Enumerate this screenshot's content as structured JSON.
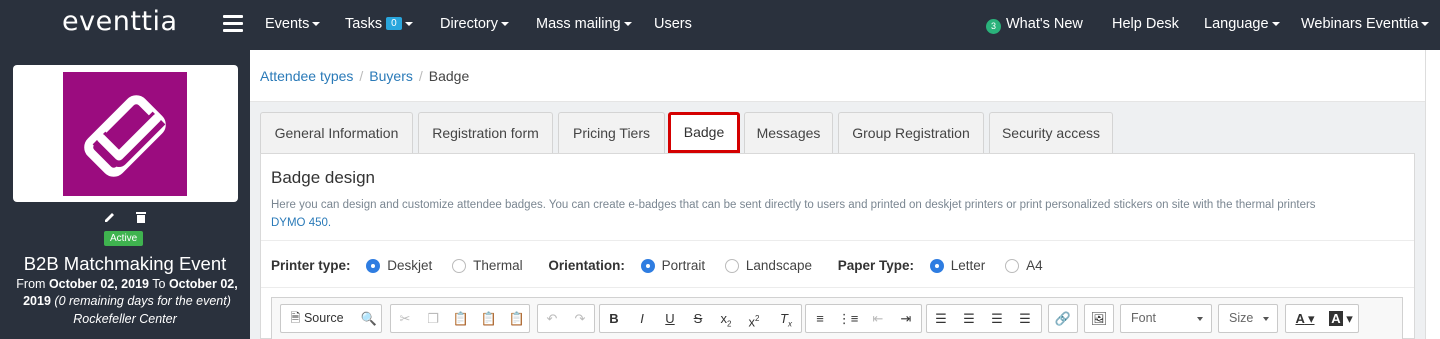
{
  "navbar": {
    "logo": "eventtia",
    "items": [
      {
        "label": "Events"
      },
      {
        "label": "Tasks",
        "badge": "0"
      },
      {
        "label": "Directory"
      },
      {
        "label": "Mass mailing"
      },
      {
        "label": "Users"
      }
    ],
    "whats_new_count": "3",
    "whats_new": "What's New",
    "help_desk": "Help Desk",
    "language": "Language",
    "account": "Webinars Eventtia"
  },
  "sidebar": {
    "status": "Active",
    "event_name": "B2B Matchmaking Event",
    "date_from_label": "From",
    "date_from": "October 02, 2019",
    "date_to_label": "To",
    "date_to": "October 02, 2019",
    "remaining": "(0 remaining days for the event)",
    "location": "Rockefeller Center"
  },
  "breadcrumb": {
    "items": [
      "Attendee types",
      "Buyers"
    ],
    "current": "Badge"
  },
  "tabs": [
    {
      "label": "General Information"
    },
    {
      "label": "Registration form"
    },
    {
      "label": "Pricing Tiers"
    },
    {
      "label": "Badge"
    },
    {
      "label": "Messages"
    },
    {
      "label": "Group Registration"
    },
    {
      "label": "Security access"
    }
  ],
  "badge": {
    "title": "Badge design",
    "description": "Here you can design and customize attendee badges. You can create e-badges that can be sent directly to users and printed on deskjet printers or print personalized stickers on site with the thermal printers",
    "description_link": "DYMO 450.",
    "printer_type": {
      "label": "Printer type:",
      "options": [
        "Deskjet",
        "Thermal"
      ],
      "selected": "Deskjet"
    },
    "orientation": {
      "label": "Orientation:",
      "options": [
        "Portrait",
        "Landscape"
      ],
      "selected": "Portrait"
    },
    "paper_type": {
      "label": "Paper Type:",
      "options": [
        "Letter",
        "A4"
      ],
      "selected": "Letter"
    }
  },
  "editor": {
    "source_label": "Source",
    "font_label": "Font",
    "size_label": "Size",
    "bold": "B",
    "italic": "I",
    "underline": "U",
    "strike": "S",
    "subscript_base": "x",
    "subscript_mark": "2",
    "superscript_base": "x",
    "superscript_mark": "2",
    "remove_format": "T",
    "remove_format_mark": "x",
    "text_color": "A",
    "bg_color": "A"
  },
  "colors": {
    "navbar_bg": "#2a313d",
    "active_tab_border": "#d40000",
    "link": "#2a7ab8",
    "badge_blue": "#29a6dd",
    "active_green": "#3fb34f",
    "event_logo": "#9b0c7f",
    "radio_on": "#2f7de1"
  }
}
